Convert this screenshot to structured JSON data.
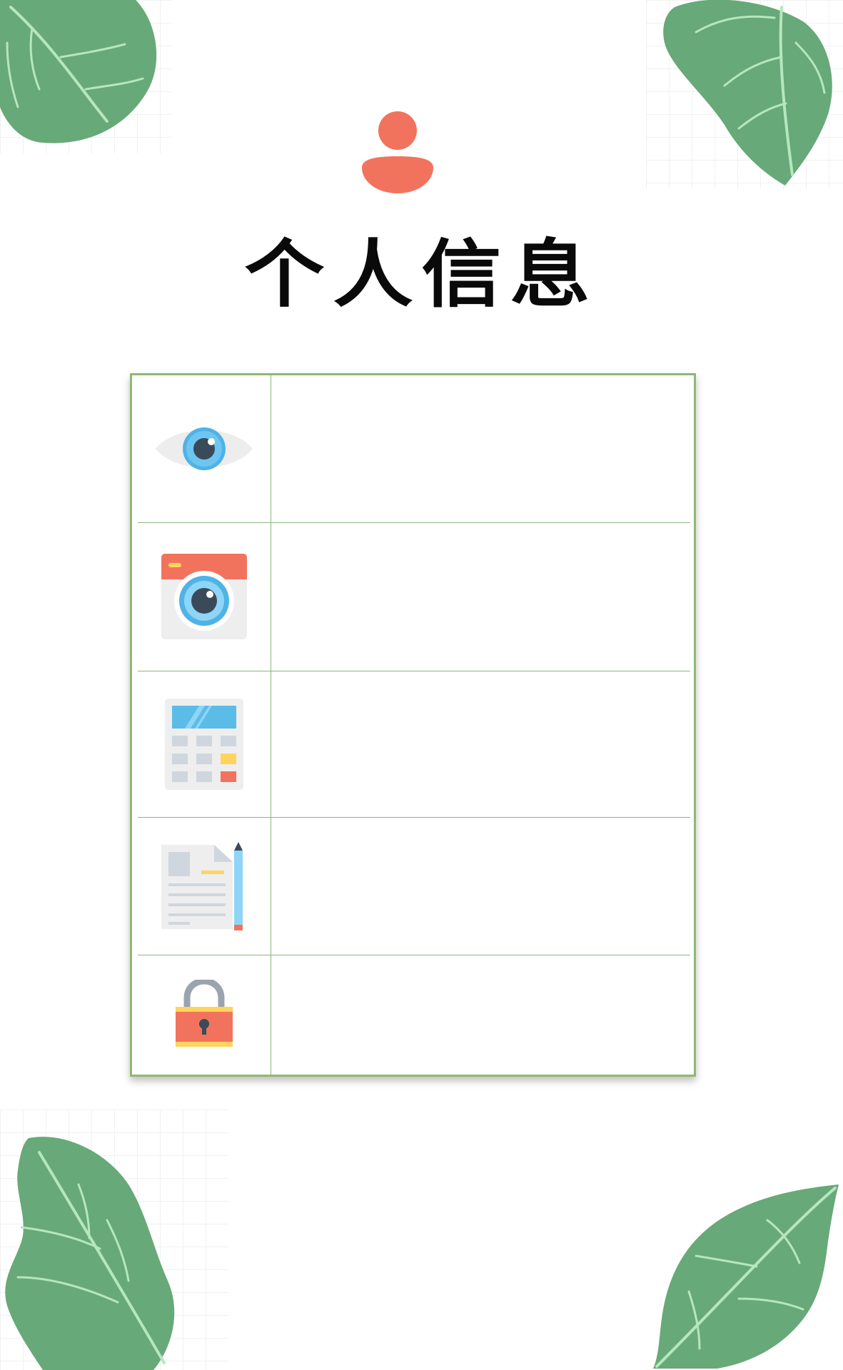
{
  "title": "个人信息",
  "icons": {
    "avatar": "person-icon",
    "rows": [
      "eye-icon",
      "camera-icon",
      "calculator-icon",
      "document-pencil-icon",
      "padlock-icon"
    ]
  },
  "colors": {
    "leaf": "#67a978",
    "leaf_vein": "#b6e6c0",
    "accent": "#f2735d",
    "table_border": "#8fb870",
    "row_line": "#8cb57b",
    "title": "#0a0a0a"
  },
  "rows": [
    {
      "value": ""
    },
    {
      "value": ""
    },
    {
      "value": ""
    },
    {
      "value": ""
    },
    {
      "value": ""
    }
  ]
}
